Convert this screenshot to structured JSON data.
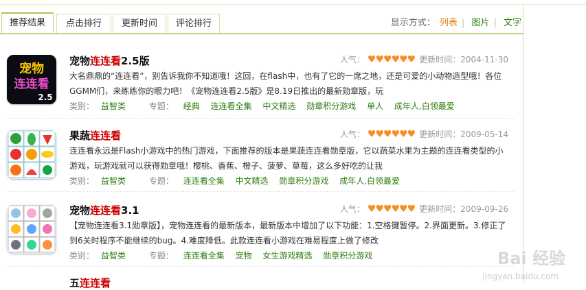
{
  "tabs": [
    "推荐结果",
    "点击排行",
    "更新时间",
    "评论排行"
  ],
  "display": {
    "label": "显示方式：",
    "options": [
      "列表",
      "图片",
      "文字"
    ]
  },
  "items": [
    {
      "title_pre": "宠物",
      "title_hl": "连连看",
      "title_post": "2.5版",
      "pop_label": "人气：",
      "hearts": "♥♥♥♥♥♥",
      "update_label": "更新时间：",
      "date": "2004-11-30",
      "desc": "大名鼎鼎的“连连看”，别告诉我你不知道哦！这回，在flash中，也有了它的一席之地，还是可爱的小动物造型哦！各位GGMM们，来练练你的眼力吧！《宠物连连看2.5版》是8.19日推出的最新勋章版，玩",
      "category_label": "类别：",
      "category": "益智类",
      "topic_label": "专题：",
      "topics": [
        "经典",
        "连连看全集",
        "中文精选",
        "勋章积分游戏",
        "单人",
        "成年人,白领最爱"
      ],
      "icon": "pet-link-2-5-icon"
    },
    {
      "title_pre": "果蔬",
      "title_hl": "连连看",
      "title_post": "",
      "pop_label": "人气：",
      "hearts": "♥♥♥♥♥♥",
      "update_label": "更新时间：",
      "date": "2009-05-14",
      "desc": "连连看永远是Flash小游戏中的热门游戏，下面推荐的版本是果蔬连连看勋章版，它以蔬菜水果为主题的连连看类型的小游戏，玩游戏就可以获得勋章哦！樱桃、香蕉、橙子、菠萝、草莓，这么多好吃的让我",
      "category_label": "类别：",
      "category": "益智类",
      "topic_label": "专题：",
      "topics": [
        "连连看全集",
        "中文精选",
        "勋章积分游戏",
        "成年人,白领最爱"
      ],
      "icon": "fruit-veg-icon"
    },
    {
      "title_pre": "宠物",
      "title_hl": "连连看",
      "title_post": "3.1",
      "pop_label": "人气：",
      "hearts": "♥♥♥♥♥♥",
      "update_label": "更新时间：",
      "date": "2009-09-26",
      "desc": "【宠物连连看3.1勋章版】，宠物连连看的最新版本，最新版本中增加了以下功能：1.空格键暂停。2.界面更新。3.修正了到6关时程序不能继续的bug。4.难度降低。此款连连看小游戏在难易程度上做了修改",
      "category_label": "类别：",
      "category": "益智类",
      "topic_label": "专题：",
      "topics": [
        "连连看全集",
        "宠物",
        "女生游戏精选",
        "勋章积分游戏"
      ],
      "icon": "pet-grid-icon"
    },
    {
      "title_pre": "五",
      "title_hl": "连连看"
    }
  ],
  "watermark": {
    "main": "Bai 经验",
    "sub": "jingyan.baidu.com"
  }
}
